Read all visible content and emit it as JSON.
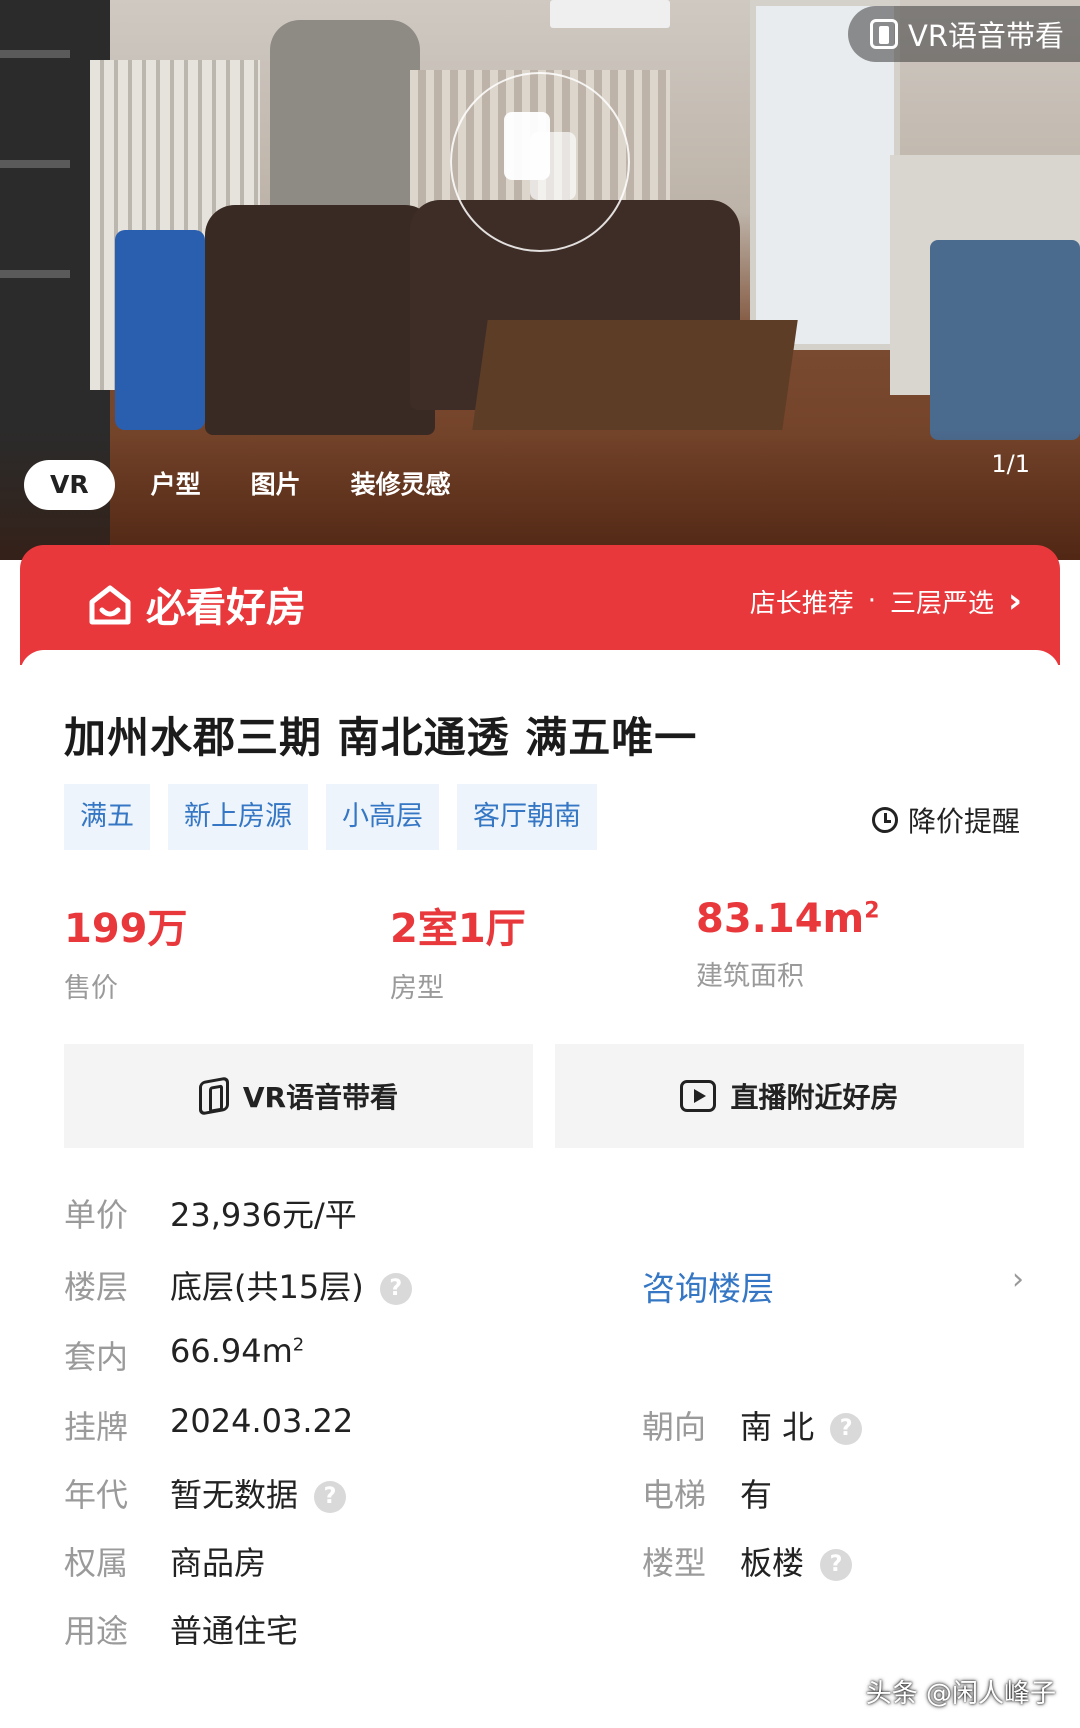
{
  "hero": {
    "vr_guide_label": "VR语音带看",
    "tabs": [
      {
        "label": "VR",
        "active": true
      },
      {
        "label": "户型",
        "active": false
      },
      {
        "label": "图片",
        "active": false
      },
      {
        "label": "装修灵感",
        "active": false
      }
    ],
    "counter": "1/1"
  },
  "banner": {
    "logo_text": "必看好房",
    "recommend": "店长推荐",
    "separator": "·",
    "selection": "三层严选",
    "chevron": "›"
  },
  "listing": {
    "title": "加州水郡三期 南北通透 满五唯一",
    "tags": [
      "满五",
      "新上房源",
      "小高层",
      "客厅朝南"
    ],
    "price_alert": "降价提醒",
    "stats": [
      {
        "value": "199万",
        "label": "售价"
      },
      {
        "value": "2室1厅",
        "label": "房型"
      },
      {
        "value": "83.14m",
        "unit_sup": "2",
        "label": "建筑面积"
      }
    ],
    "actions": [
      {
        "label": "VR语音带看",
        "icon": "vr-icon"
      },
      {
        "label": "直播附近好房",
        "icon": "live-play-icon"
      }
    ]
  },
  "details": {
    "unit_price": {
      "key": "单价",
      "value": "23,936元/平"
    },
    "floor": {
      "key": "楼层",
      "value": "底层(共15层)",
      "link": "咨询楼层"
    },
    "inner_area": {
      "key": "套内",
      "value": "66.94m",
      "unit_sup": "2"
    },
    "listed": {
      "key": "挂牌",
      "value": "2024.03.22"
    },
    "orientation": {
      "key": "朝向",
      "value": "南 北"
    },
    "built_year": {
      "key": "年代",
      "value": "暂无数据"
    },
    "elevator": {
      "key": "电梯",
      "value": "有"
    },
    "ownership": {
      "key": "权属",
      "value": "商品房"
    },
    "building_type": {
      "key": "楼型",
      "value": "板楼"
    },
    "usage": {
      "key": "用途",
      "value": "普通住宅"
    },
    "help_glyph": "?"
  },
  "watermark": "头条 @闲人峰子",
  "colors": {
    "accent_red": "#e8383b",
    "link_blue": "#3577c4",
    "tag_bg": "#eef4fb",
    "muted": "#9a9a9a"
  }
}
